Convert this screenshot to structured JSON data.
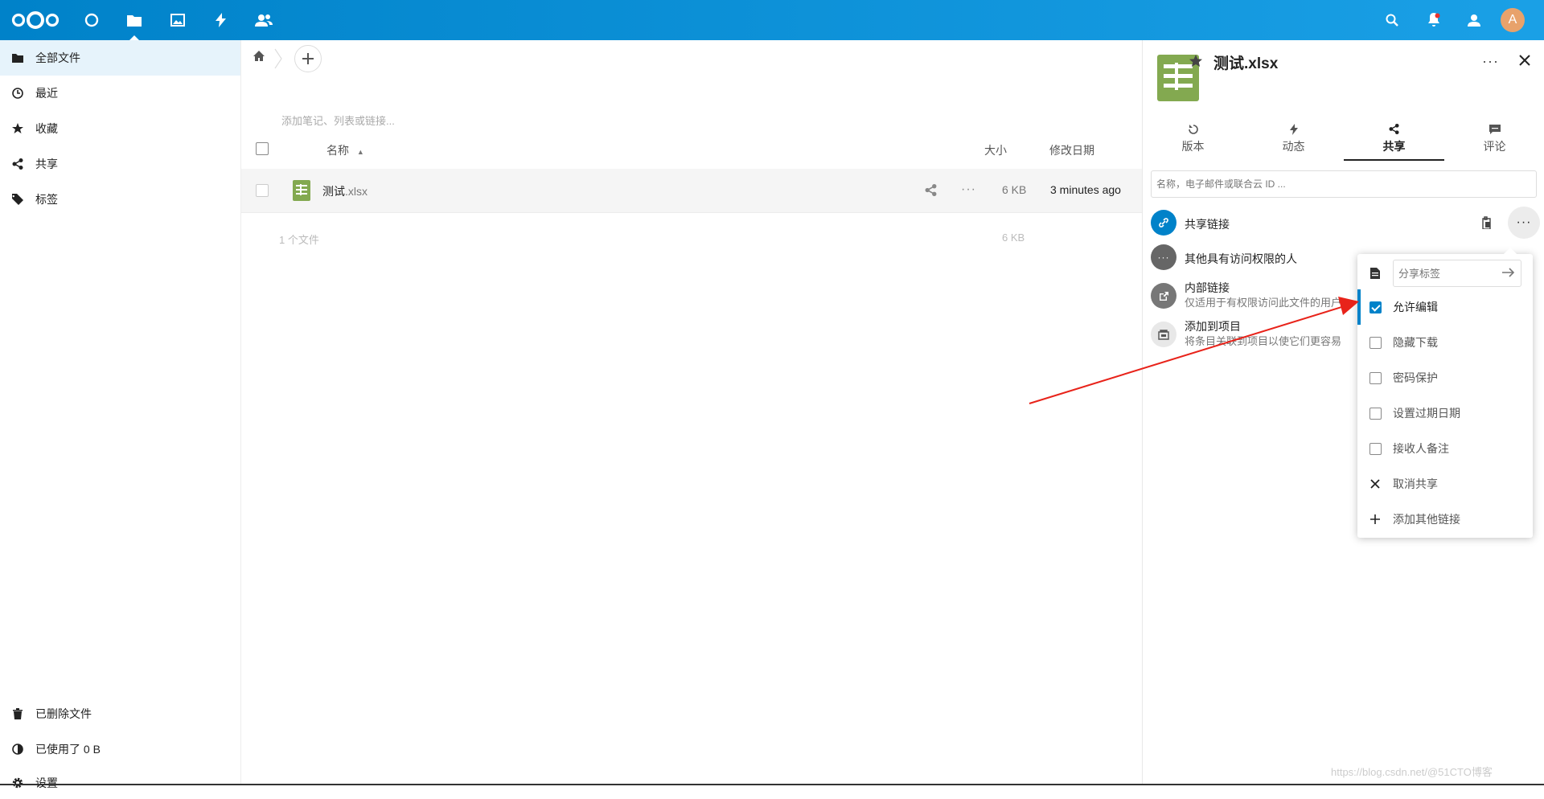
{
  "header": {
    "avatar_letter": "A"
  },
  "nav": {
    "items": [
      {
        "label": "全部文件"
      },
      {
        "label": "最近"
      },
      {
        "label": "收藏"
      },
      {
        "label": "共享"
      },
      {
        "label": "标签"
      }
    ],
    "bottom": [
      {
        "label": "已删除文件"
      },
      {
        "label": "已使用了 0 B"
      },
      {
        "label": "设置"
      }
    ]
  },
  "main": {
    "notes_placeholder": "添加笔记、列表或链接...",
    "columns": {
      "name": "名称",
      "size": "大小",
      "modified": "修改日期"
    },
    "files": [
      {
        "name": "测试",
        "ext": ".xlsx",
        "size": "6 KB",
        "modified": "3 minutes ago"
      }
    ],
    "summary": {
      "count": "1 个文件",
      "size": "6 KB"
    }
  },
  "sidebar": {
    "title": "测试.xlsx",
    "tabs": [
      {
        "label": "版本"
      },
      {
        "label": "动态"
      },
      {
        "label": "共享"
      },
      {
        "label": "评论"
      }
    ],
    "search_placeholder": "名称，电子邮件或联合云 ID ...",
    "shares": [
      {
        "title": "共享链接"
      },
      {
        "title": "其他具有访问权限的人"
      },
      {
        "title": "内部链接",
        "subtitle": "仅适用于有权限访问此文件的用户"
      },
      {
        "title": "添加到项目",
        "subtitle": "将条目关联到项目以使它们更容易"
      }
    ],
    "accent_color": "#0082c9"
  },
  "popover": {
    "label_placeholder": "分享标签",
    "options": [
      {
        "label": "允许编辑",
        "checked": true
      },
      {
        "label": "隐藏下载",
        "checked": false
      },
      {
        "label": "密码保护",
        "checked": false
      },
      {
        "label": "设置过期日期",
        "checked": false
      },
      {
        "label": "接收人备注",
        "checked": false
      }
    ],
    "actions": [
      {
        "label": "取消共享",
        "icon": "close-icon"
      },
      {
        "label": "添加其他链接",
        "icon": "plus-icon"
      }
    ]
  },
  "watermark": "https://blog.csdn.net/@51CTO博客"
}
